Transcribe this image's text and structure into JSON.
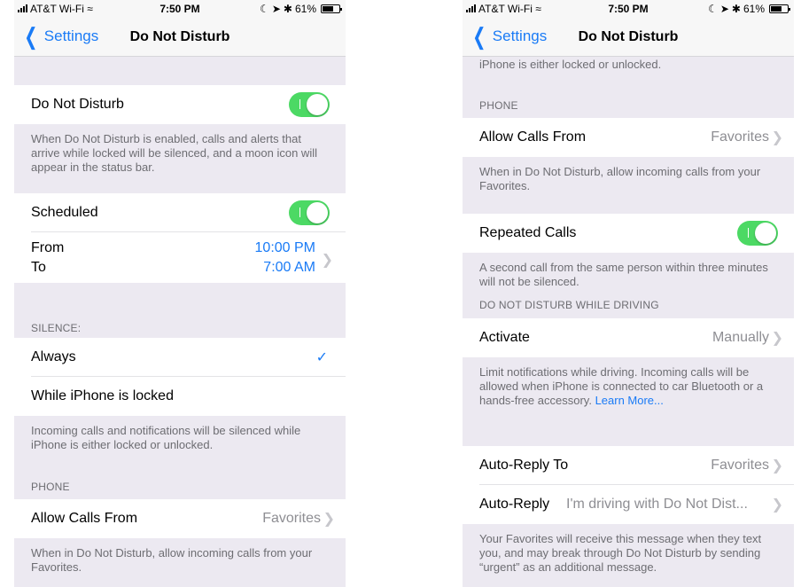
{
  "status": {
    "carrier": "AT&T Wi-Fi",
    "time": "7:50 PM",
    "battery": "61%"
  },
  "nav": {
    "back_label": "Settings",
    "title": "Do Not Disturb"
  },
  "left": {
    "dnd": {
      "label": "Do Not Disturb",
      "enabled": true
    },
    "dnd_footer": "When Do Not Disturb is enabled, calls and alerts that arrive while locked will be silenced, and a moon icon will appear in the status bar.",
    "scheduled": {
      "label": "Scheduled",
      "enabled": true
    },
    "schedule": {
      "from_label": "From",
      "from_value": "10:00 PM",
      "to_label": "To",
      "to_value": "7:00 AM"
    },
    "silence_header": "SILENCE:",
    "silence_options": [
      {
        "label": "Always",
        "selected": true
      },
      {
        "label": "While iPhone is locked",
        "selected": false
      }
    ],
    "silence_footer": "Incoming calls and notifications will be silenced while iPhone is either locked or unlocked.",
    "phone_header": "PHONE",
    "allow_calls": {
      "label": "Allow Calls From",
      "value": "Favorites"
    },
    "allow_calls_footer": "When in Do Not Disturb, allow incoming calls from your Favorites."
  },
  "right": {
    "top_footer_fragment": "iPhone is either locked or unlocked.",
    "phone_header": "PHONE",
    "allow_calls": {
      "label": "Allow Calls From",
      "value": "Favorites"
    },
    "allow_calls_footer": "When in Do Not Disturb, allow incoming calls from your Favorites.",
    "repeated_calls": {
      "label": "Repeated Calls",
      "enabled": true
    },
    "repeated_footer": "A second call from the same person within three minutes will not be silenced.",
    "driving_header": "DO NOT DISTURB WHILE DRIVING",
    "activate": {
      "label": "Activate",
      "value": "Manually"
    },
    "driving_footer": "Limit notifications while driving. Incoming calls will be allowed when iPhone is connected to car Bluetooth or a hands-free accessory.",
    "learn_more": "Learn More...",
    "auto_reply_to": {
      "label": "Auto-Reply To",
      "value": "Favorites"
    },
    "auto_reply": {
      "label": "Auto-Reply",
      "value": "I'm driving with Do Not Dist..."
    },
    "auto_reply_footer": "Your Favorites will receive this message when they text you, and may break through Do Not Disturb by sending “urgent” as an additional message."
  },
  "colors": {
    "accent": "#1a7bf6",
    "toggle_on": "#4cd964",
    "grouped_background": "#ece9f1"
  },
  "icons": {
    "back": "chevron-left-icon",
    "disclosure": "chevron-right-icon",
    "checkmark": "checkmark-icon"
  }
}
